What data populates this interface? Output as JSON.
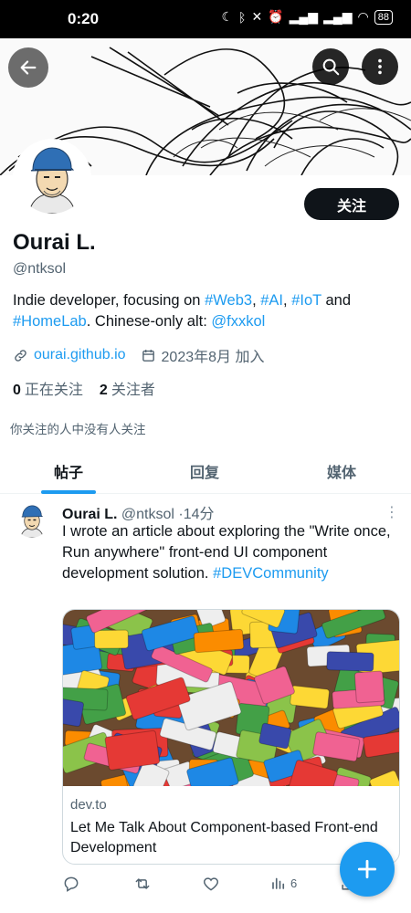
{
  "status_bar": {
    "time": "0:20",
    "battery": "88",
    "icons": [
      "moon-icon",
      "bluetooth-icon",
      "mute-icon",
      "alarm-icon",
      "signal-icon",
      "signal-icon",
      "wifi-icon",
      "battery-icon"
    ]
  },
  "header": {
    "icons": [
      "back-arrow-icon",
      "search-icon",
      "more-vertical-icon"
    ]
  },
  "profile": {
    "follow_label": "关注",
    "name": "Ourai L.",
    "handle": "@ntksol",
    "bio": {
      "t1": "Indie developer, focusing on ",
      "tag_web3": "#Web3",
      "sep1": ", ",
      "tag_ai": "#AI",
      "sep2": ", ",
      "tag_iot": "#IoT",
      "t2": " and ",
      "tag_homelab": "#HomeLab",
      "t3": ". Chinese-only alt: ",
      "mention": "@fxxkol"
    },
    "website": "ourai.github.io",
    "joined": "2023年8月 加入",
    "following_count": "0",
    "following_label": "正在关注",
    "followers_count": "2",
    "followers_label": "关注者",
    "no_mutual": "你关注的人中没有人关注"
  },
  "tabs": [
    {
      "label": "帖子",
      "active": true
    },
    {
      "label": "回复"
    },
    {
      "label": "媒体"
    }
  ],
  "post": {
    "name": "Ourai L.",
    "handle": "@ntksol",
    "dot": "·",
    "time": "14分",
    "text": "I wrote an article about exploring the \"Write once, Run anywhere\" front-end UI component development solution.",
    "hashtag": "#DEVCommunity",
    "card": {
      "domain": "dev.to",
      "title": "Let Me Talk About Component-based Front-end Development"
    },
    "actions": {
      "views": "6"
    }
  },
  "colors": {
    "accent": "#1d9bf0",
    "text": "#0f1419",
    "muted": "#536471"
  }
}
